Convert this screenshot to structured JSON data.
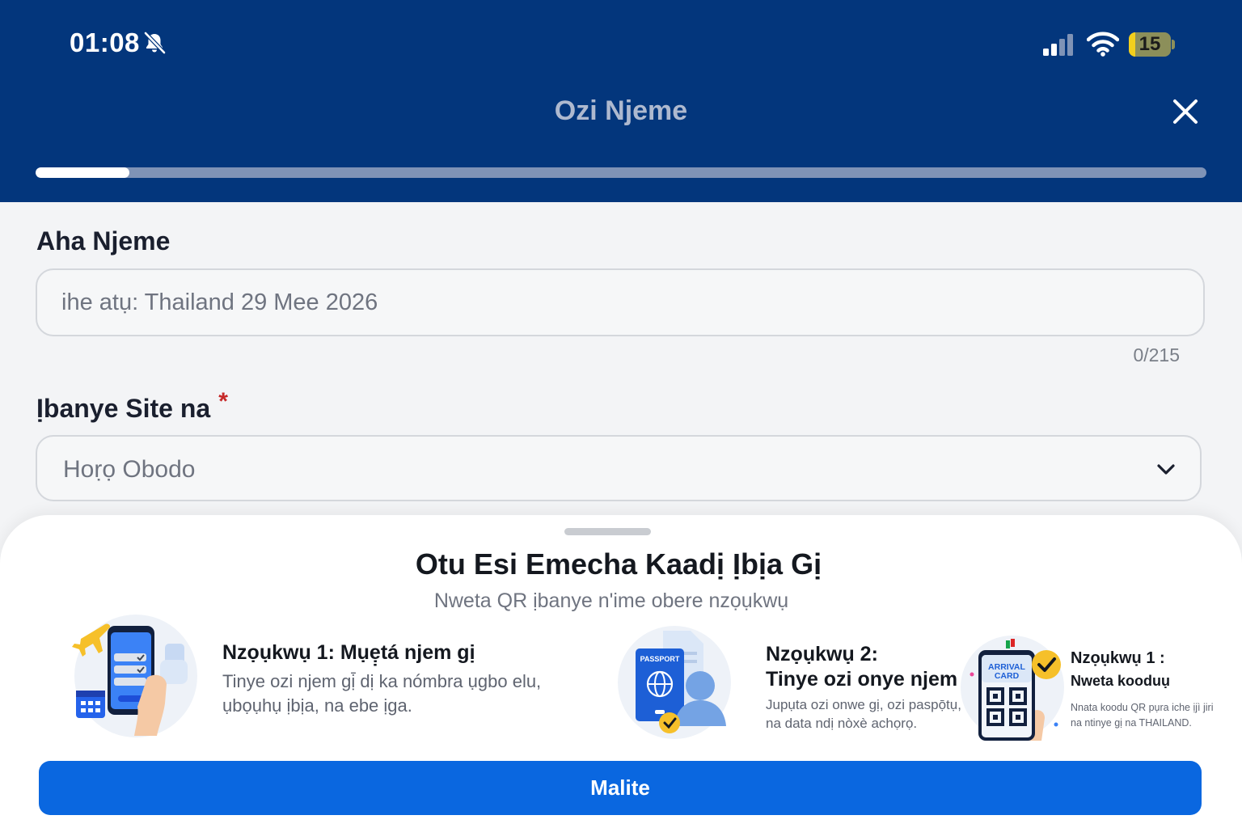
{
  "status_bar": {
    "time": "01:08",
    "battery_level": "15",
    "battery_fraction": 0.15
  },
  "header": {
    "title": "Ozi Njeme",
    "close_icon": "close-icon",
    "progress_fraction": 0.08
  },
  "form": {
    "trip_name": {
      "label": "Aha Njeme",
      "value": "",
      "placeholder": "ihe atụ: Thailand 29 Mee 2026",
      "counter": "0/215"
    },
    "departure": {
      "label": "Ịbanye Site na",
      "required_mark": "*",
      "selected": "Hoṛọ Obodo",
      "icon": "chevron-down-icon"
    }
  },
  "sheet": {
    "title": "Otu Esi Emecha Kaadị Ịbịa Gị",
    "subtitle": "Nweta QR ịbanye n'ime obere nzọụkwụ",
    "steps": [
      {
        "title": "Nzọụkwụ 1: Mụẹ̣tá njem gị",
        "description_line1": "Tinye ozi njem gị̄ dị ka nómbra ụgbo elu,",
        "description_line2": "ụbọụhụ ịbịa, na ebe ịga.",
        "icon": "phone-checklist-icon"
      },
      {
        "title_line1": "Nzọụkwụ 2:",
        "title_line2": "Tinye ozi onye njem",
        "description_line1": "Jupụta ozi onwe gị, ozi paspọ̄tụ,",
        "description_line2": "na data ndị nòxè achọrọ.",
        "icon": "passport-icon",
        "illustration_text": "PASSPORT"
      },
      {
        "title_line1": "Nzọụkwụ 1 :",
        "title_line2": "Nweta kooduụ",
        "description_line1": "Nnata koodu QR pụra iche ịjì jiri",
        "description_line2": "na ntinye gị na THAILAND.",
        "icon": "qr-arrival-card-icon",
        "illustration_text_line1": "ARRIVAL",
        "illustration_text_line2": "CARD"
      }
    ]
  },
  "actions": {
    "continue_label": "Malite"
  },
  "colors": {
    "header_bg": "#03367c",
    "primary_button": "#0a67e0",
    "required_red": "#c62828"
  }
}
